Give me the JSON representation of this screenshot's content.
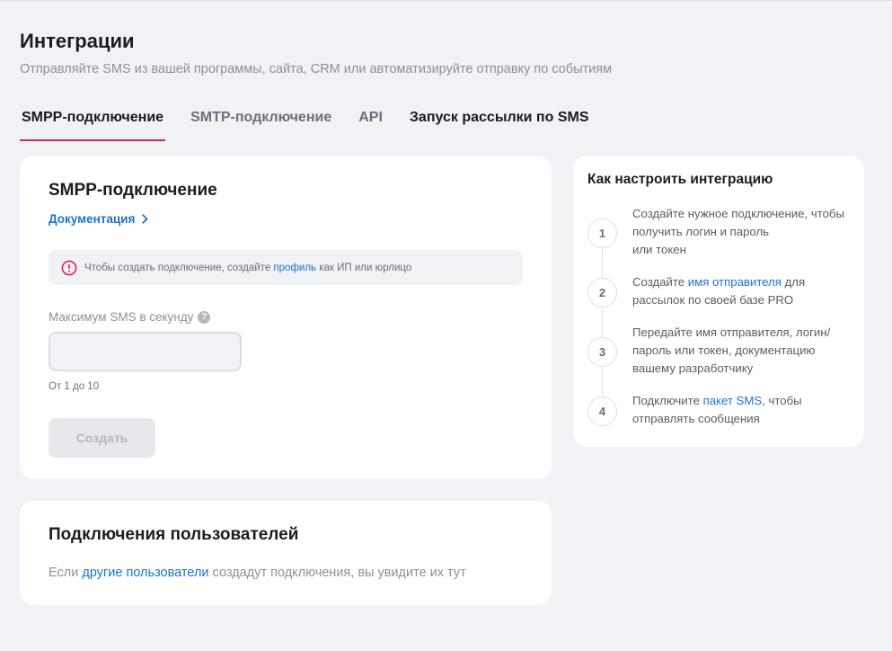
{
  "header": {
    "title": "Интеграции",
    "subtitle": "Отправляйте SMS из вашей программы, сайта, CRM или автоматизируйте отправку по событиям"
  },
  "tabs": [
    {
      "label": "SMPP-подключение",
      "active": true
    },
    {
      "label": "SMTP-подключение",
      "active": false
    },
    {
      "label": "API",
      "active": false
    },
    {
      "label": "Запуск рассылки по SMS",
      "active": false
    }
  ],
  "smpp": {
    "title": "SMPP-подключение",
    "doc_link": "Документация",
    "notice": {
      "before": "Чтобы создать подключение, создайте ",
      "link": "профиль",
      "after": " как ИП или юрлицо"
    },
    "field_label": "Максимум SMS в секунду",
    "help_glyph": "?",
    "field_value": "",
    "field_hint": "От 1 до 10",
    "create_label": "Создать"
  },
  "users": {
    "title": "Подключения пользователей",
    "text_before": "Если ",
    "link": "другие пользователи",
    "text_after": " создадут подключения, вы увидите их тут"
  },
  "guide": {
    "title": "Как настроить интеграцию",
    "steps": [
      {
        "num": "1",
        "before": "Создайте нужное подключение, чтобы получить логин и пароль",
        "link": "",
        "after": "или токен"
      },
      {
        "num": "2",
        "before": "Создайте ",
        "link": "имя отправителя",
        "after": " для рассылок по своей базе PRO"
      },
      {
        "num": "3",
        "before": "Передайте имя отправителя, логин/пароль или токен, документацию вашему разработчику",
        "link": "",
        "after": ""
      },
      {
        "num": "4",
        "before": "Подключите ",
        "link": "пакет SMS",
        "after": ", чтобы отправлять сообщения"
      }
    ]
  },
  "colors": {
    "accent": "#e3224b",
    "link": "#1e73c8",
    "warning": "#e3224b",
    "background": "#f1f2f6"
  }
}
